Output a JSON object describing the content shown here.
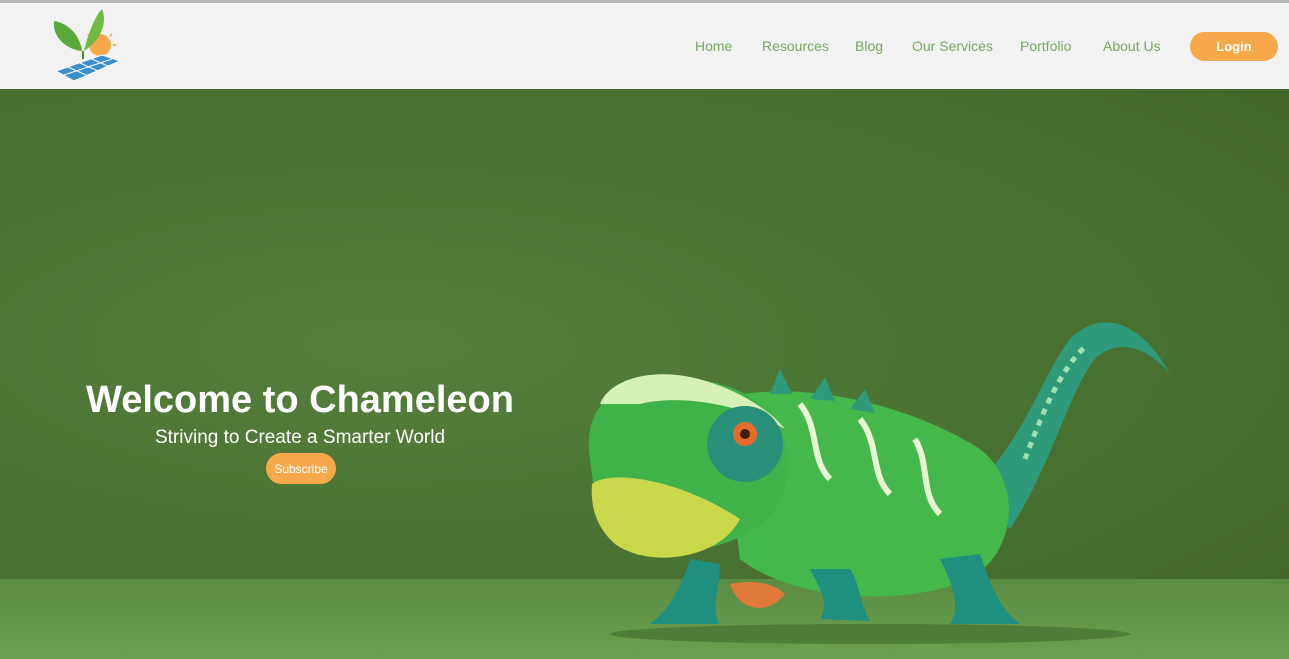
{
  "header": {
    "logo": {
      "icon": "sprout-sun-solar-panel-logo"
    },
    "nav": [
      {
        "label": "Home"
      },
      {
        "label": "Resources"
      },
      {
        "label": "Blog"
      },
      {
        "label": "Our Services"
      },
      {
        "label": "Portfolio"
      },
      {
        "label": "About Us"
      }
    ],
    "login_label": "Login"
  },
  "hero": {
    "title": "Welcome to Chameleon",
    "subtitle": "Striving to Create a Smarter World",
    "subscribe_label": "Subscribe",
    "image": "chameleon-illustration"
  },
  "colors": {
    "nav_text": "#76a860",
    "accent": "#f6a84a",
    "header_bg": "#f2f2f2",
    "hero_bg": "#4b7434"
  }
}
